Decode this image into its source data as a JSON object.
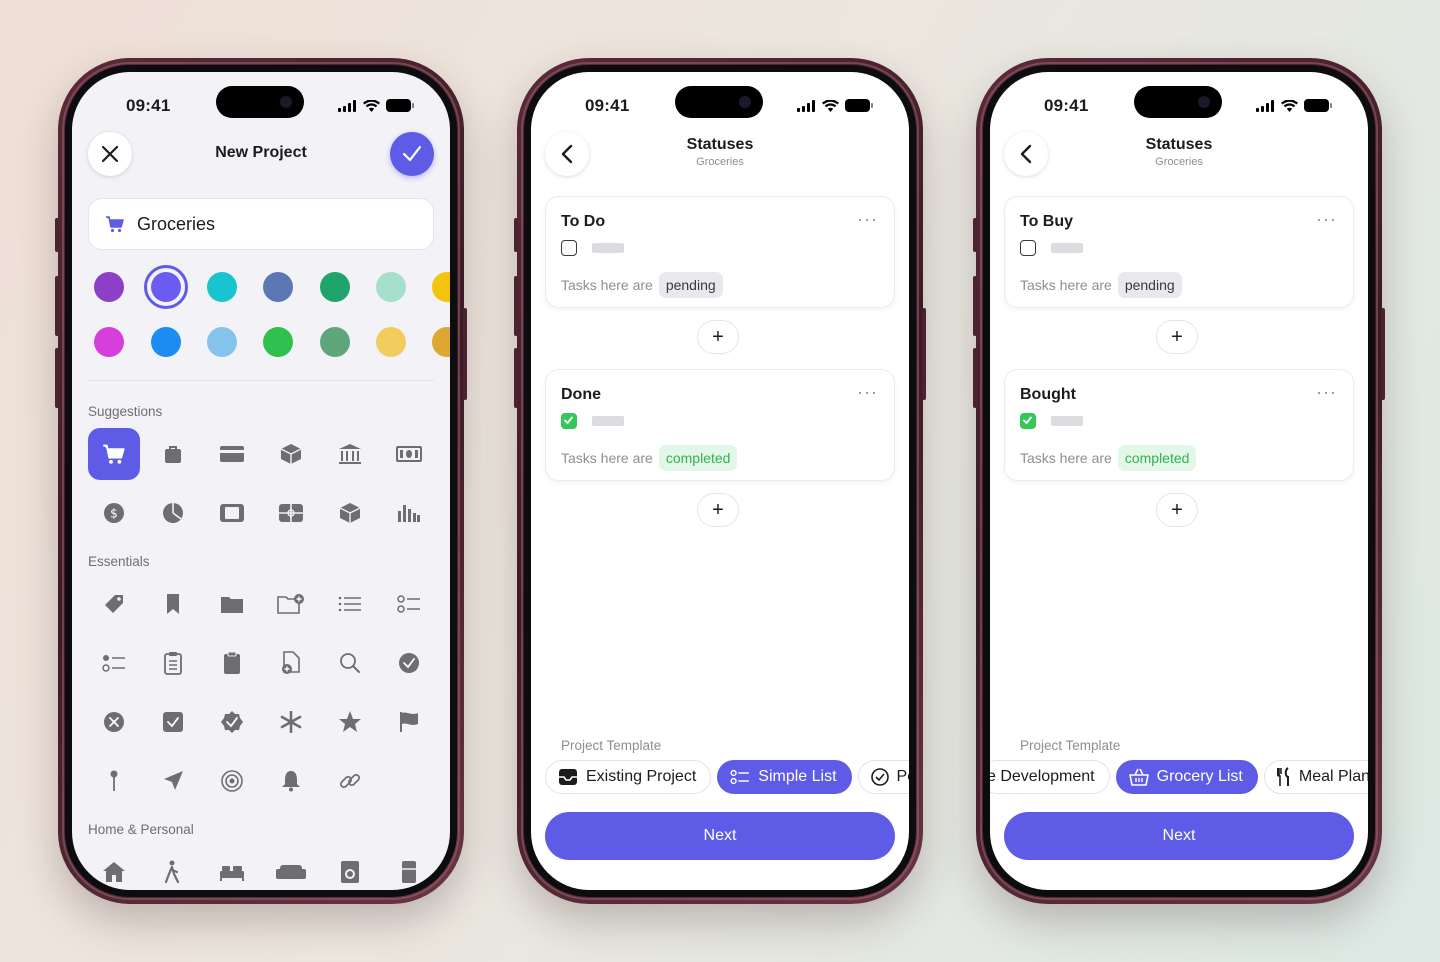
{
  "colors": {
    "accent": "#5e5ce6",
    "green": "#34c759",
    "icon_gray": "#6d6d72"
  },
  "status_bar": {
    "time": "09:41"
  },
  "phone1": {
    "title": "New Project",
    "project_name": "Groceries",
    "colors_row1": [
      "#8e3fc7",
      "#6a5cf0",
      "#17c4cf",
      "#5b78b4",
      "#1fa46b",
      "#a6e0cb",
      "#f4c30e"
    ],
    "colors_row2": [
      "#d63fdc",
      "#1a8cf2",
      "#86c3ec",
      "#2fc04f",
      "#5fa67a",
      "#f3cc5e",
      "#e0a632"
    ],
    "selected_color": "#6a5cf0",
    "suggestions_label": "Suggestions",
    "essentials_label": "Essentials",
    "home_label": "Home & Personal"
  },
  "phone2": {
    "title": "Statuses",
    "subtitle": "Groceries",
    "card1": {
      "title": "To Do",
      "desc": "Tasks here are",
      "state": "pending"
    },
    "card2": {
      "title": "Done",
      "desc": "Tasks here are",
      "state": "completed"
    },
    "template_label": "Project Template",
    "templates": [
      "Existing Project",
      "Simple List",
      "Pe"
    ],
    "next": "Next"
  },
  "phone3": {
    "title": "Statuses",
    "subtitle": "Groceries",
    "card1": {
      "title": "To Buy",
      "desc": "Tasks here are",
      "state": "pending"
    },
    "card2": {
      "title": "Bought",
      "desc": "Tasks here are",
      "state": "completed"
    },
    "template_label": "Project Template",
    "templates": [
      "e Development",
      "Grocery List",
      "Meal Plan"
    ],
    "next": "Next"
  }
}
